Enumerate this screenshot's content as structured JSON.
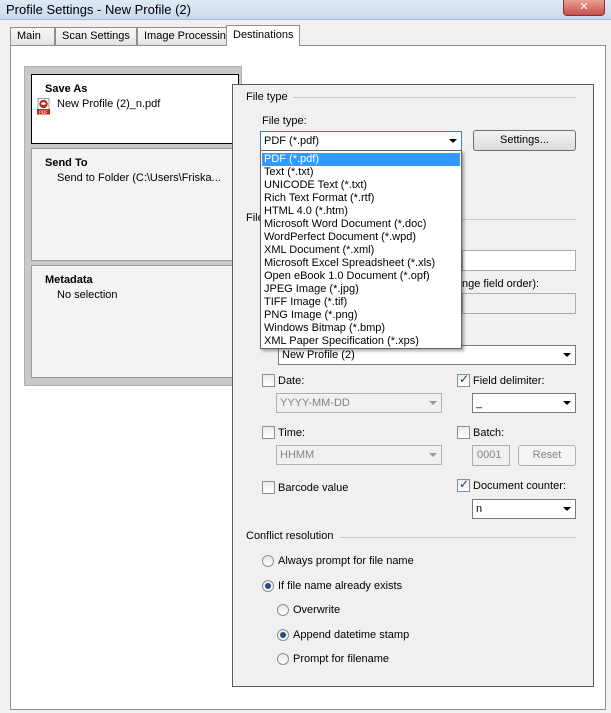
{
  "window": {
    "title": "Profile Settings - New Profile (2)"
  },
  "tabs": [
    "Main",
    "Scan Settings",
    "Image Processing",
    "Destinations"
  ],
  "left_pane": {
    "items": [
      {
        "title": "Save As",
        "subtitle": "New Profile (2)_n.pdf"
      },
      {
        "title": "Send To",
        "subtitle": "Send to Folder (C:\\Users\\Friska..."
      },
      {
        "title": "Metadata",
        "subtitle": "No selection"
      }
    ]
  },
  "file_type": {
    "group_label": "File type",
    "field_label": "File type:",
    "selected": "PDF (*.pdf)",
    "settings_button": "Settings...",
    "options": [
      "PDF (*.pdf)",
      "Text (*.txt)",
      "UNICODE Text (*.txt)",
      "Rich Text Format (*.rtf)",
      "HTML 4.0 (*.htm)",
      "Microsoft Word Document (*.doc)",
      "WordPerfect Document (*.wpd)",
      "XML Document (*.xml)",
      "Microsoft Excel Spreadsheet (*.xls)",
      "Open eBook 1.0 Document (*.opf)",
      "JPEG Image (*.jpg)",
      "TIFF Image (*.tif)",
      "PNG Image (*.png)",
      "Windows Bitmap (*.bmp)",
      "XML Paper Specification (*.xps)"
    ]
  },
  "file_name": {
    "group_label_partial": "File",
    "order_label_partial": "nge field order):",
    "profile_combo": "New Profile (2)",
    "date_label": "Date:",
    "date_format": "YYYY-MM-DD",
    "time_label": "Time:",
    "time_format": "HHMM",
    "barcode_label": "Barcode value",
    "field_delimiter_label": "Field delimiter:",
    "field_delimiter_value": "_",
    "batch_label": "Batch:",
    "batch_value": "0001",
    "reset_button": "Reset",
    "document_counter_label": "Document counter:",
    "document_counter_value": "n"
  },
  "conflict": {
    "group_label": "Conflict resolution",
    "always_prompt": "Always prompt for file name",
    "if_exists": "If file name already exists",
    "overwrite": "Overwrite",
    "append": "Append datetime stamp",
    "prompt_filename": "Prompt for filename"
  }
}
